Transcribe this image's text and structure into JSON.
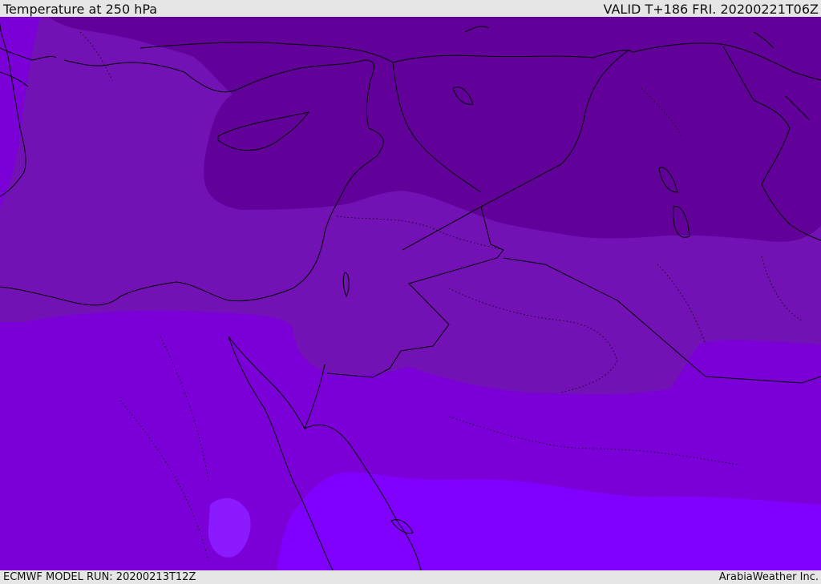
{
  "header": {
    "title": "Temperature at 250 hPa",
    "valid": "VALID T+186 FRI. 20200221T06Z"
  },
  "footer": {
    "model_run": "ECMWF MODEL RUN: 20200213T12Z",
    "credit": "ArabiaWeather Inc."
  },
  "colors": {
    "band_darkest": "#62009a",
    "band_dark": "#7211b4",
    "band_mid": "#7b00d8",
    "band_bright": "#8000ff",
    "band_light": "#8c1aff",
    "border": "#000000"
  }
}
